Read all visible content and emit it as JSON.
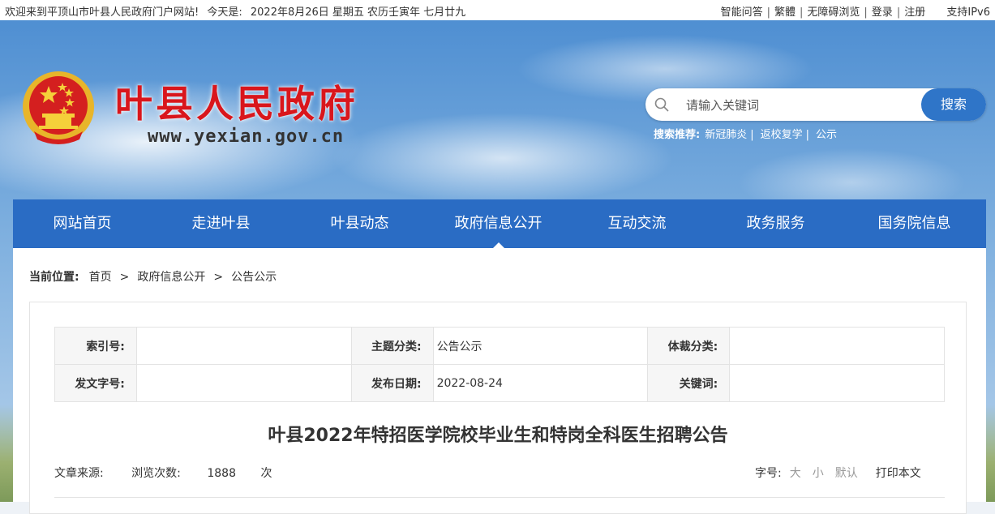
{
  "topbar": {
    "welcome": "欢迎来到平顶山市叶县人民政府门户网站!",
    "today_label": "今天是:",
    "date": "2022年8月26日 星期五 农历壬寅年 七月廿九",
    "links": [
      "智能问答",
      "繁體",
      "无障碍浏览",
      "登录",
      "注册"
    ],
    "ipv6": "支持IPv6"
  },
  "header": {
    "site_title": "叶县人民政府",
    "site_url": "www.yexian.gov.cn",
    "search_placeholder": "请输入关键词",
    "search_button": "搜索",
    "hot_label": "搜索推荐:",
    "hot_items": [
      "新冠肺炎",
      "返校复学",
      "公示"
    ]
  },
  "nav": {
    "items": [
      "网站首页",
      "走进叶县",
      "叶县动态",
      "政府信息公开",
      "互动交流",
      "政务服务",
      "国务院信息"
    ],
    "active_index": 3
  },
  "breadcrumb": {
    "label": "当前位置:",
    "items": [
      "首页",
      "政府信息公开",
      "公告公示"
    ],
    "separator": ">"
  },
  "meta": {
    "index_no_label": "索引号:",
    "index_no": "",
    "topic_label": "主题分类:",
    "topic": "公告公示",
    "genre_label": "体裁分类:",
    "genre": "",
    "doc_no_label": "发文字号:",
    "doc_no": "",
    "date_label": "发布日期:",
    "date": "2022-08-24",
    "keywords_label": "关键词:",
    "keywords": ""
  },
  "article": {
    "title": "叶县2022年特招医学院校毕业生和特岗全科医生招聘公告",
    "source_label": "文章来源:",
    "views_label": "浏览次数:",
    "views": "1888",
    "views_unit": "次",
    "font_label": "字号:",
    "font_large": "大",
    "font_small": "小",
    "font_default": "默认",
    "print": "打印本文"
  },
  "colors": {
    "nav_bg": "#2a6cc4",
    "title_red": "#d9161c",
    "search_button": "#2f75c8"
  }
}
